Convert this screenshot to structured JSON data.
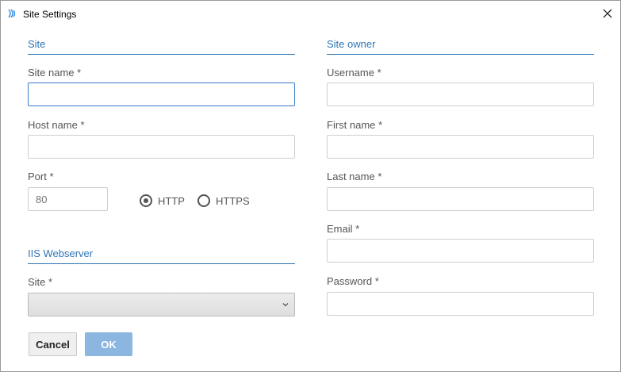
{
  "window": {
    "title": "Site Settings",
    "icon": "app-logo-icon",
    "close_icon": "close-icon"
  },
  "site": {
    "header": "Site",
    "site_name_label": "Site name *",
    "site_name_value": "",
    "host_name_label": "Host name *",
    "host_name_value": "",
    "port_label": "Port *",
    "port_placeholder": "80",
    "protocol_options": [
      {
        "label": "HTTP",
        "selected": true
      },
      {
        "label": "HTTPS",
        "selected": false
      }
    ]
  },
  "iis": {
    "header": "IIS Webserver",
    "site_label": "Site *",
    "site_selected": ""
  },
  "owner": {
    "header": "Site owner",
    "username_label": "Username *",
    "first_name_label": "First name *",
    "last_name_label": "Last name *",
    "email_label": "Email *",
    "password_label": "Password *"
  },
  "actions": {
    "cancel_label": "Cancel",
    "ok_label": "OK"
  },
  "colors": {
    "accent": "#2e75b6",
    "ok_button": "#8ab6e0",
    "focus_border": "#3b7dc6"
  }
}
